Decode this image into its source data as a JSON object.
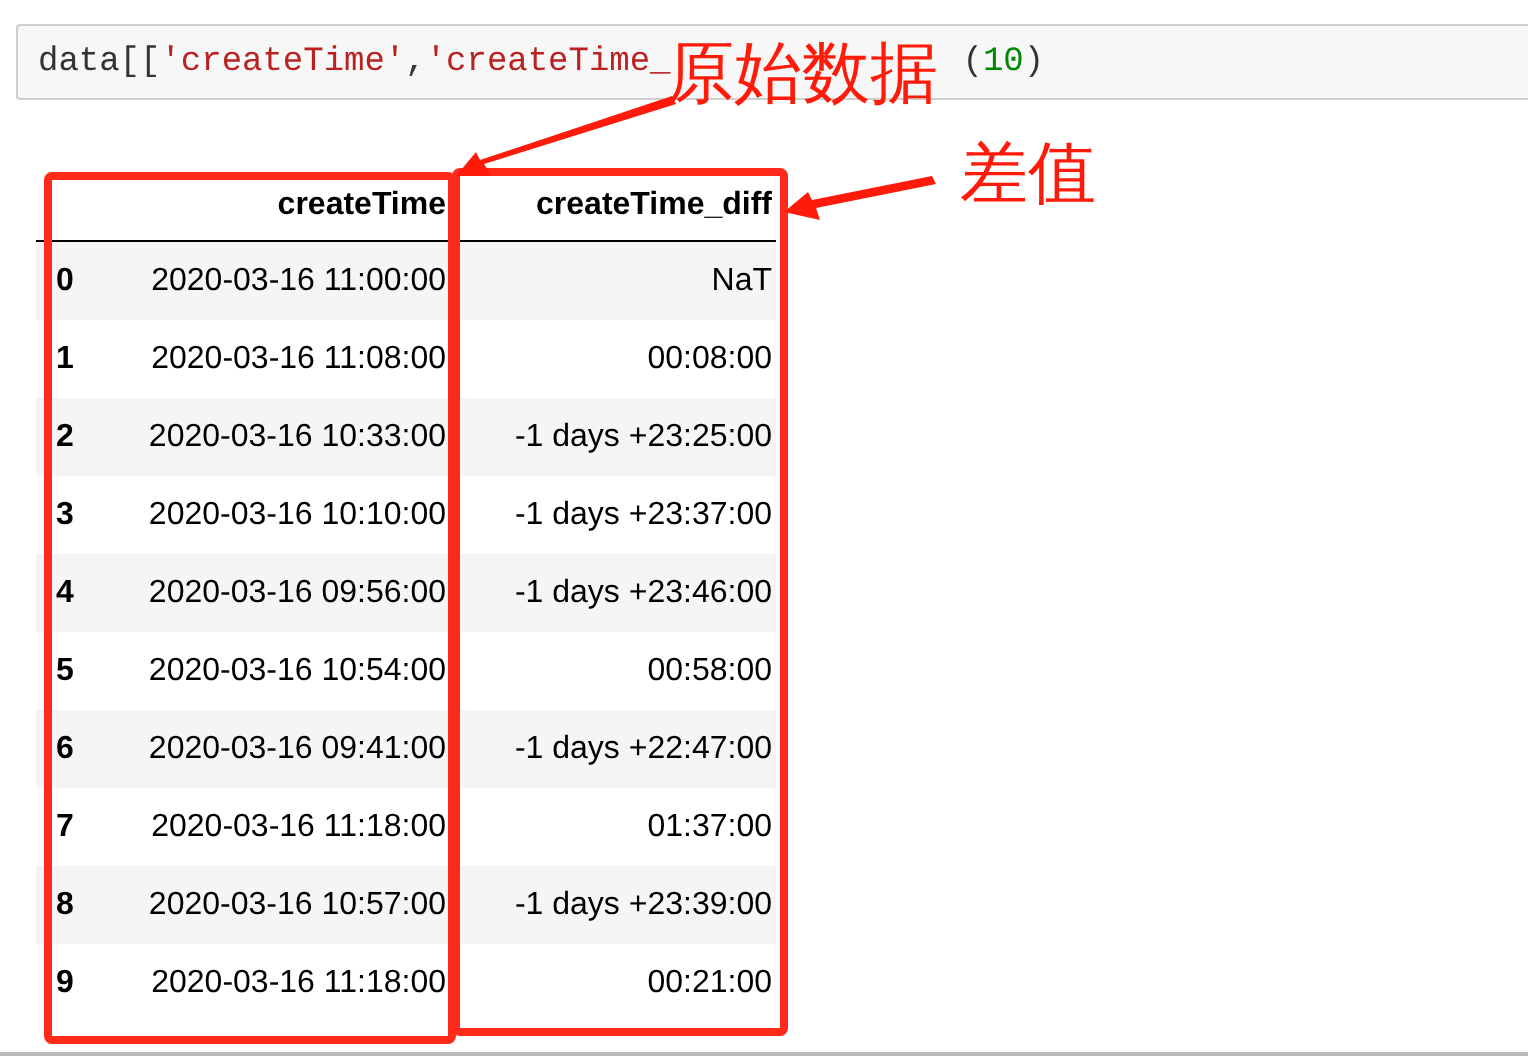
{
  "code_cell": {
    "tokens": [
      {
        "kind": "name",
        "text": "data[["
      },
      {
        "kind": "string",
        "text": "'createTime'"
      },
      {
        "kind": "name",
        "text": ","
      },
      {
        "kind": "string",
        "text": "'createTime_",
        "covered_after": true
      },
      {
        "kind": "name",
        "text": "("
      },
      {
        "kind": "number",
        "text": "10"
      },
      {
        "kind": "name",
        "text": ")"
      }
    ]
  },
  "table": {
    "columns": [
      "createTime",
      "createTime_diff"
    ],
    "rows": [
      {
        "index": "0",
        "cells": [
          "2020-03-16 11:00:00",
          "NaT"
        ]
      },
      {
        "index": "1",
        "cells": [
          "2020-03-16 11:08:00",
          "00:08:00"
        ]
      },
      {
        "index": "2",
        "cells": [
          "2020-03-16 10:33:00",
          "-1 days +23:25:00"
        ]
      },
      {
        "index": "3",
        "cells": [
          "2020-03-16 10:10:00",
          "-1 days +23:37:00"
        ]
      },
      {
        "index": "4",
        "cells": [
          "2020-03-16 09:56:00",
          "-1 days +23:46:00"
        ]
      },
      {
        "index": "5",
        "cells": [
          "2020-03-16 10:54:00",
          "00:58:00"
        ]
      },
      {
        "index": "6",
        "cells": [
          "2020-03-16 09:41:00",
          "-1 days +22:47:00"
        ]
      },
      {
        "index": "7",
        "cells": [
          "2020-03-16 11:18:00",
          "01:37:00"
        ]
      },
      {
        "index": "8",
        "cells": [
          "2020-03-16 10:57:00",
          "-1 days +23:39:00"
        ]
      },
      {
        "index": "9",
        "cells": [
          "2020-03-16 11:18:00",
          "00:21:00"
        ]
      }
    ]
  },
  "annotations": [
    {
      "text": "原始数据"
    },
    {
      "text": "差值"
    }
  ]
}
